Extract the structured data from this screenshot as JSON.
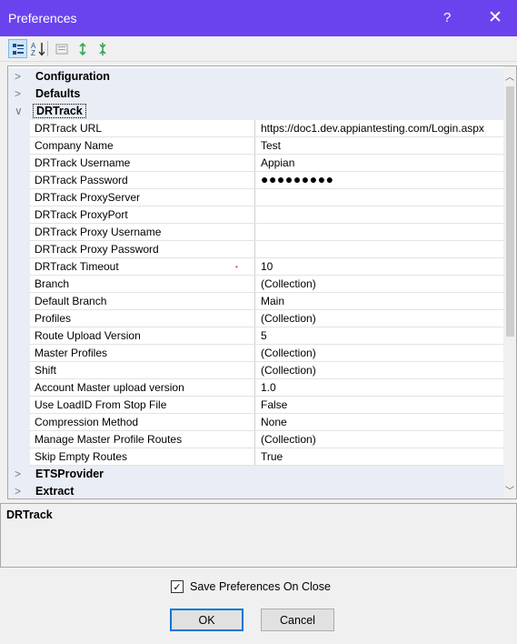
{
  "window": {
    "title": "Preferences",
    "help_glyph": "?",
    "close_glyph": "✕"
  },
  "toolbar": {
    "icons": [
      "categorized-view-icon",
      "alphabetical-sort-icon",
      "property-pages-icon",
      "expand-all-icon",
      "collapse-all-icon"
    ],
    "sort_glyph_top": "A",
    "sort_glyph_bottom": "Z"
  },
  "grid": {
    "categories": {
      "configuration": "Configuration",
      "defaults": "Defaults",
      "drtrack": "DRTrack",
      "etsprovider": "ETSProvider",
      "extract": "Extract"
    },
    "properties": [
      {
        "name": "DRTrack URL",
        "value": "https://doc1.dev.appiantesting.com/Login.aspx"
      },
      {
        "name": "Company Name",
        "value": "Test"
      },
      {
        "name": "DRTrack Username",
        "value": "Appian"
      },
      {
        "name": "DRTrack Password",
        "value": "●●●●●●●●●"
      },
      {
        "name": "DRTrack ProxyServer",
        "value": ""
      },
      {
        "name": "DRTrack ProxyPort",
        "value": ""
      },
      {
        "name": "DRTrack Proxy Username",
        "value": ""
      },
      {
        "name": "DRTrack Proxy Password",
        "value": ""
      },
      {
        "name": "DRTrack Timeout",
        "value": "10"
      },
      {
        "name": "Branch",
        "value": "(Collection)"
      },
      {
        "name": "Default Branch",
        "value": "Main"
      },
      {
        "name": "Profiles",
        "value": "(Collection)"
      },
      {
        "name": "Route Upload Version",
        "value": "5"
      },
      {
        "name": "Master Profiles",
        "value": "(Collection)"
      },
      {
        "name": "Shift",
        "value": "(Collection)"
      },
      {
        "name": "Account Master upload version",
        "value": "1.0"
      },
      {
        "name": "Use LoadID From Stop File",
        "value": "False"
      },
      {
        "name": "Compression Method",
        "value": "None"
      },
      {
        "name": "Manage Master Profile Routes",
        "value": "(Collection)"
      },
      {
        "name": "Skip Empty Routes",
        "value": "True"
      }
    ],
    "collapsed_glyph": ">",
    "expanded_glyph": "∨",
    "marker_glyph": "•"
  },
  "description": {
    "title": "DRTrack"
  },
  "footer": {
    "save_on_close_label": "Save Preferences On Close",
    "save_on_close_checked": true,
    "check_glyph": "✓",
    "ok_label": "OK",
    "cancel_label": "Cancel"
  },
  "colors": {
    "titlebar": "#6b43ee",
    "category_band": "#e9edf5",
    "focus_border": "#0078d7"
  }
}
